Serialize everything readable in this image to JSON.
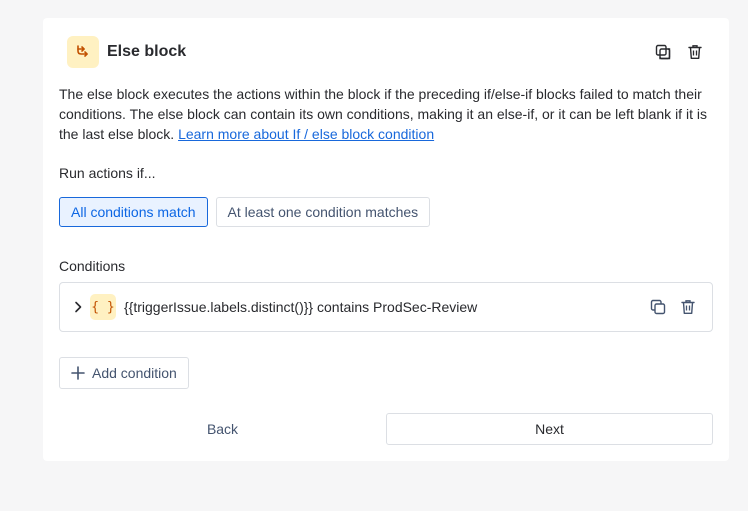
{
  "block": {
    "title": "Else block",
    "icon": "branch-icon",
    "accent_color": "#fff1c2"
  },
  "description": {
    "text": "The else block executes the actions within the block if the preceding if/else-if blocks failed to match their conditions. The else block can contain its own conditions, making it an else-if, or it can be left blank if it is the last else block. ",
    "link_text": "Learn more about If / else block condition"
  },
  "run_actions": {
    "label": "Run actions if...",
    "options": [
      {
        "label": "All conditions match",
        "selected": true
      },
      {
        "label": "At least one condition matches",
        "selected": false
      }
    ]
  },
  "conditions": {
    "label": "Conditions",
    "items": [
      {
        "icon_text": "{ }",
        "text": "{{triggerIssue.labels.distinct()}} contains ProdSec-Review"
      }
    ],
    "add_label": "Add condition"
  },
  "footer": {
    "back_label": "Back",
    "next_label": "Next"
  },
  "colors": {
    "selected_bg": "#e9f2ff",
    "selected_border": "#1868db",
    "link": "#1868db"
  }
}
